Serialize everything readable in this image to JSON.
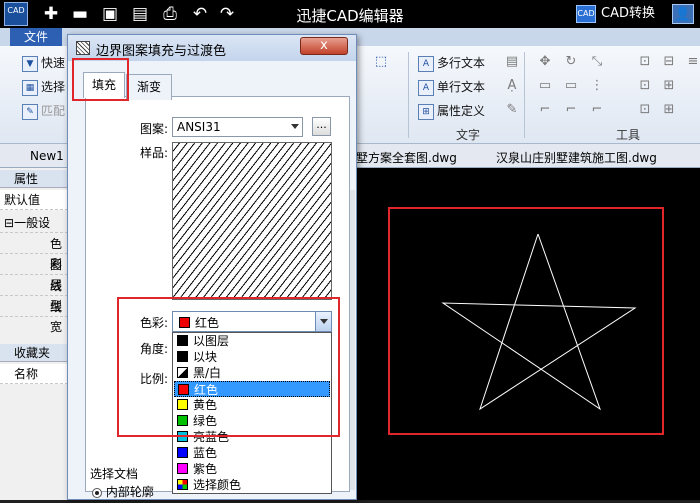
{
  "app": {
    "logo_text": "CAD",
    "title": "迅捷CAD编辑器",
    "cad_convert_badge": "CAD",
    "cad_convert_label": "CAD转换",
    "user_icon": "user-icon"
  },
  "quick_access": [
    "new-icon",
    "open-folder-icon",
    "save-icon",
    "save-as-icon",
    "print-icon",
    "undo-icon",
    "redo-icon"
  ],
  "ribbon": {
    "file_tab": "文件",
    "left_items": [
      "快速",
      "选择",
      "匹配"
    ],
    "text_group": {
      "items": [
        "多行文本",
        "单行文本",
        "属性定义"
      ],
      "label": "文字"
    },
    "tools_group_label": "工具"
  },
  "doc_tabs": [
    "New1",
    "墅方案全套图.dwg",
    "汉泉山庄别墅建筑施工图.dwg"
  ],
  "left_panel": {
    "header": "属性",
    "default_value": "默认值",
    "general_section": "一般设",
    "rows": [
      "色彩",
      "图层",
      "线型",
      "线宽"
    ],
    "favorites_header": "收藏夹",
    "name_header": "名称"
  },
  "dialog": {
    "title": "边界图案填充与过渡色",
    "close_label": "x",
    "tabs": [
      "填充",
      "渐变"
    ],
    "pattern_label": "图案:",
    "pattern_value": "ANSI31",
    "browse_label": "...",
    "sample_label": "样品:",
    "color_label": "色彩:",
    "color_value": "红色",
    "angle_label": "角度:",
    "scale_label": "比例:",
    "select_doc_label": "选择文档",
    "inner_outline_label": "内部轮廓"
  },
  "color_options": [
    {
      "label": "以图层",
      "color": "#000000"
    },
    {
      "label": "以块",
      "color": "#000000"
    },
    {
      "label": "黑/白",
      "color": "bw"
    },
    {
      "label": "红色",
      "color": "#ff0000",
      "selected": true
    },
    {
      "label": "黄色",
      "color": "#ffff00"
    },
    {
      "label": "绿色",
      "color": "#00c000"
    },
    {
      "label": "亮蓝色",
      "color": "#00c0e0"
    },
    {
      "label": "蓝色",
      "color": "#0000ff"
    },
    {
      "label": "紫色",
      "color": "#ff00ff"
    },
    {
      "label": "选择颜色",
      "color": "multi"
    }
  ],
  "colors": {
    "highlight_box": "#e0262b",
    "selected_option": "#3399ff",
    "canvas_bg": "#000000",
    "star_stroke": "#ffffff"
  }
}
